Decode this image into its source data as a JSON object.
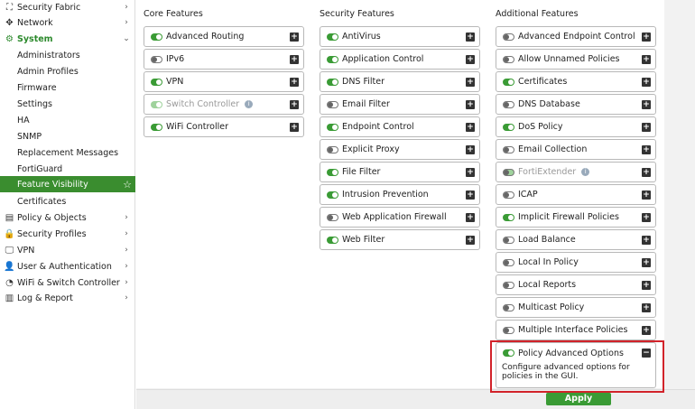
{
  "sidebar": {
    "items": [
      {
        "label": "Security Fabric",
        "icon": "security-fabric-icon",
        "glyph": "⛶",
        "chevron": "›"
      },
      {
        "label": "Network",
        "icon": "network-icon",
        "glyph": "✥",
        "chevron": "›"
      },
      {
        "label": "System",
        "icon": "gear-icon",
        "glyph": "⚙",
        "chevron": "⌄"
      },
      {
        "label": "Administrators"
      },
      {
        "label": "Admin Profiles"
      },
      {
        "label": "Firmware"
      },
      {
        "label": "Settings"
      },
      {
        "label": "HA"
      },
      {
        "label": "SNMP"
      },
      {
        "label": "Replacement Messages"
      },
      {
        "label": "FortiGuard"
      },
      {
        "label": "Feature Visibility",
        "active": true,
        "star": "☆"
      },
      {
        "label": "Certificates"
      },
      {
        "label": "Policy & Objects",
        "icon": "policy-objects-icon",
        "glyph": "▤",
        "chevron": "›"
      },
      {
        "label": "Security Profiles",
        "icon": "lock-icon",
        "glyph": "🔒",
        "chevron": "›"
      },
      {
        "label": "VPN",
        "icon": "monitor-icon",
        "glyph": "🖵",
        "chevron": "›"
      },
      {
        "label": "User & Authentication",
        "icon": "user-icon",
        "glyph": "👤",
        "chevron": "›"
      },
      {
        "label": "WiFi & Switch Controller",
        "icon": "wifi-icon",
        "glyph": "◔",
        "chevron": "›"
      },
      {
        "label": "Log & Report",
        "icon": "chart-icon",
        "glyph": "▥",
        "chevron": "›"
      }
    ]
  },
  "columns": [
    {
      "title": "Core Features",
      "features": [
        {
          "label": "Advanced Routing",
          "on": true
        },
        {
          "label": "IPv6",
          "on": false
        },
        {
          "label": "VPN",
          "on": true
        },
        {
          "label": "Switch Controller",
          "on": true,
          "disabled": true,
          "info": true
        },
        {
          "label": "WiFi Controller",
          "on": true
        }
      ]
    },
    {
      "title": "Security Features",
      "features": [
        {
          "label": "AntiVirus",
          "on": true
        },
        {
          "label": "Application Control",
          "on": true
        },
        {
          "label": "DNS Filter",
          "on": true
        },
        {
          "label": "Email Filter",
          "on": false
        },
        {
          "label": "Endpoint Control",
          "on": true
        },
        {
          "label": "Explicit Proxy",
          "on": false
        },
        {
          "label": "File Filter",
          "on": true
        },
        {
          "label": "Intrusion Prevention",
          "on": true
        },
        {
          "label": "Web Application Firewall",
          "on": false
        },
        {
          "label": "Web Filter",
          "on": true
        }
      ]
    },
    {
      "title": "Additional Features",
      "features": [
        {
          "label": "Advanced Endpoint Control",
          "on": false
        },
        {
          "label": "Allow Unnamed Policies",
          "on": false
        },
        {
          "label": "Certificates",
          "on": true
        },
        {
          "label": "DNS Database",
          "on": false
        },
        {
          "label": "DoS Policy",
          "on": true
        },
        {
          "label": "Email Collection",
          "on": false
        },
        {
          "label": "FortiExtender",
          "on": false,
          "disabled": true,
          "info": true
        },
        {
          "label": "ICAP",
          "on": false
        },
        {
          "label": "Implicit Firewall Policies",
          "on": true
        },
        {
          "label": "Load Balance",
          "on": false
        },
        {
          "label": "Local In Policy",
          "on": false
        },
        {
          "label": "Local Reports",
          "on": false
        },
        {
          "label": "Multicast Policy",
          "on": false
        },
        {
          "label": "Multiple Interface Policies",
          "on": false
        },
        {
          "label": "Policy Advanced Options",
          "on": true,
          "expanded": true,
          "description": "Configure advanced options for policies in the GUI."
        }
      ]
    }
  ],
  "expand_glyph": "+",
  "collapse_glyph": "−",
  "info_glyph": "i",
  "apply_label": "Apply",
  "colors": {
    "accent": "#3a9b35",
    "highlight": "#d2232a"
  }
}
